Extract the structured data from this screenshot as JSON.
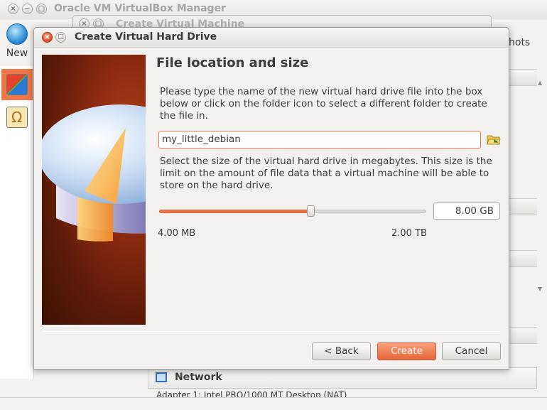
{
  "manager": {
    "title": "Oracle VM VirtualBox Manager",
    "toolbar": {
      "new_label": "New",
      "snapshots_partial": "hots"
    },
    "network": {
      "label": "Network",
      "adapter_text": "Adapter 1:  Intel PRO/1000 MT Desktop (NAT)"
    }
  },
  "create_vm_dialog": {
    "title": "Create Virtual Machine"
  },
  "dialog": {
    "title": "Create Virtual Hard Drive",
    "heading": "File location and size",
    "location_text": "Please type the name of the new virtual hard drive file into the box below or click on the folder icon to select a different folder to create the file in.",
    "file_name": "my_little_debian",
    "size_text": "Select the size of the virtual hard drive in megabytes. This size is the limit on the amount of file data that a virtual machine will be able to store on the hard drive.",
    "size_value": "8.00 GB",
    "slider_fraction": 0.57,
    "min_label": "4.00 MB",
    "max_label": "2.00 TB",
    "buttons": {
      "back": "< Back",
      "create": "Create",
      "cancel": "Cancel"
    }
  },
  "colors": {
    "accent": "#f07746",
    "close": "#e3502b"
  }
}
